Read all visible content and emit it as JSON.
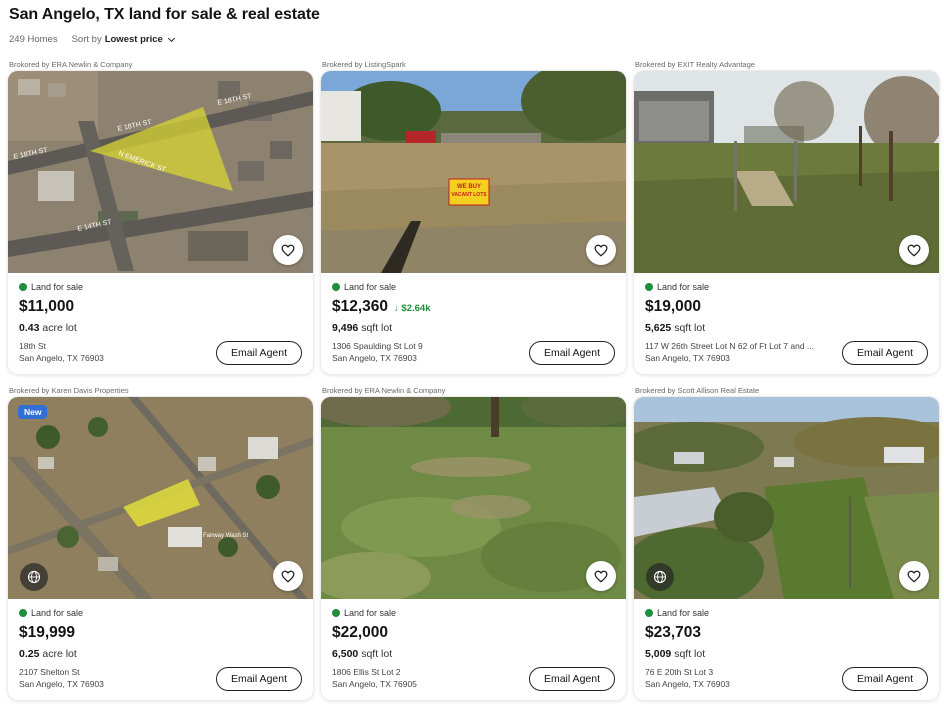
{
  "header": {
    "title": "San Angelo, TX land for sale & real estate",
    "count": "249 Homes",
    "sort_label": "Sort by",
    "sort_value": "Lowest price"
  },
  "listings": [
    {
      "broker": "Brokored by ERA Newlin & Company",
      "status": "Land for sale",
      "price": "$11,000",
      "price_drop": "",
      "lot_value": "0.43",
      "lot_unit": "acre lot",
      "addr1": "18th St",
      "addr2": "San Angelo, TX 76903",
      "button": "Email Agent",
      "badge": "",
      "photo": "aerial-streets",
      "street_labels": [
        "E 18TH ST",
        "E 18TH ST",
        "E 18TH ST",
        "N EMERICK ST",
        "E 14TH ST"
      ]
    },
    {
      "broker": "Brokered by ListingSpark",
      "status": "Land for sale",
      "price": "$12,360",
      "price_drop": "↓ $2.64k",
      "lot_value": "9,496",
      "lot_unit": "sqft lot",
      "addr1": "1306 Spaulding St Lot 9",
      "addr2": "San Angelo, TX 76903",
      "button": "Email Agent",
      "badge": "",
      "photo": "vacant-lot-sign",
      "sign_lines": [
        "WE BUY",
        "VACANT LOTS"
      ]
    },
    {
      "broker": "Brokered by EXIT Realty Advantage",
      "status": "Land for sale",
      "price": "$19,000",
      "price_drop": "",
      "lot_value": "5,625",
      "lot_unit": "sqft lot",
      "addr1": "117 W 26th Street Lot N 62 of Ft Lot 7 and ...",
      "addr2": "San Angelo, TX 76903",
      "button": "Email Agent",
      "badge": "",
      "photo": "grass-lot-trees"
    },
    {
      "broker": "Brokered by Karen Davis Properties",
      "status": "Land for sale",
      "price": "$19,999",
      "price_drop": "",
      "lot_value": "0.25",
      "lot_unit": "acre lot",
      "addr1": "2107 Shelton St",
      "addr2": "San Angelo, TX 76903",
      "button": "Email Agent",
      "badge": "New",
      "photo": "aerial-parcel",
      "street_labels": [
        "Fairway Wash St"
      ]
    },
    {
      "broker": "Brokered by ERA Newlin & Company",
      "status": "Land for sale",
      "price": "$22,000",
      "price_drop": "",
      "lot_value": "6,500",
      "lot_unit": "sqft lot",
      "addr1": "1806 Ellis St Lot 2",
      "addr2": "San Angelo, TX 76905",
      "button": "Email Agent",
      "badge": "",
      "photo": "brush-field"
    },
    {
      "broker": "Brokered by Scott Allison Real Estate",
      "status": "Land for sale",
      "price": "$23,703",
      "price_drop": "",
      "lot_value": "5,009",
      "lot_unit": "sqft lot",
      "addr1": "76 E 20th St Lot 3",
      "addr2": "San Angelo, TX 76903",
      "button": "Email Agent",
      "badge": "",
      "photo": "drone-neighborhood"
    }
  ],
  "colors": {
    "accent_green": "#1f8f3d",
    "new_badge": "#2f6fd6",
    "text_dark": "#141414"
  },
  "icons": {
    "favorite": "heart-outline-icon",
    "globe": "globe-icon",
    "sort": "chevron-down-icon",
    "status": "green-dot-icon"
  }
}
